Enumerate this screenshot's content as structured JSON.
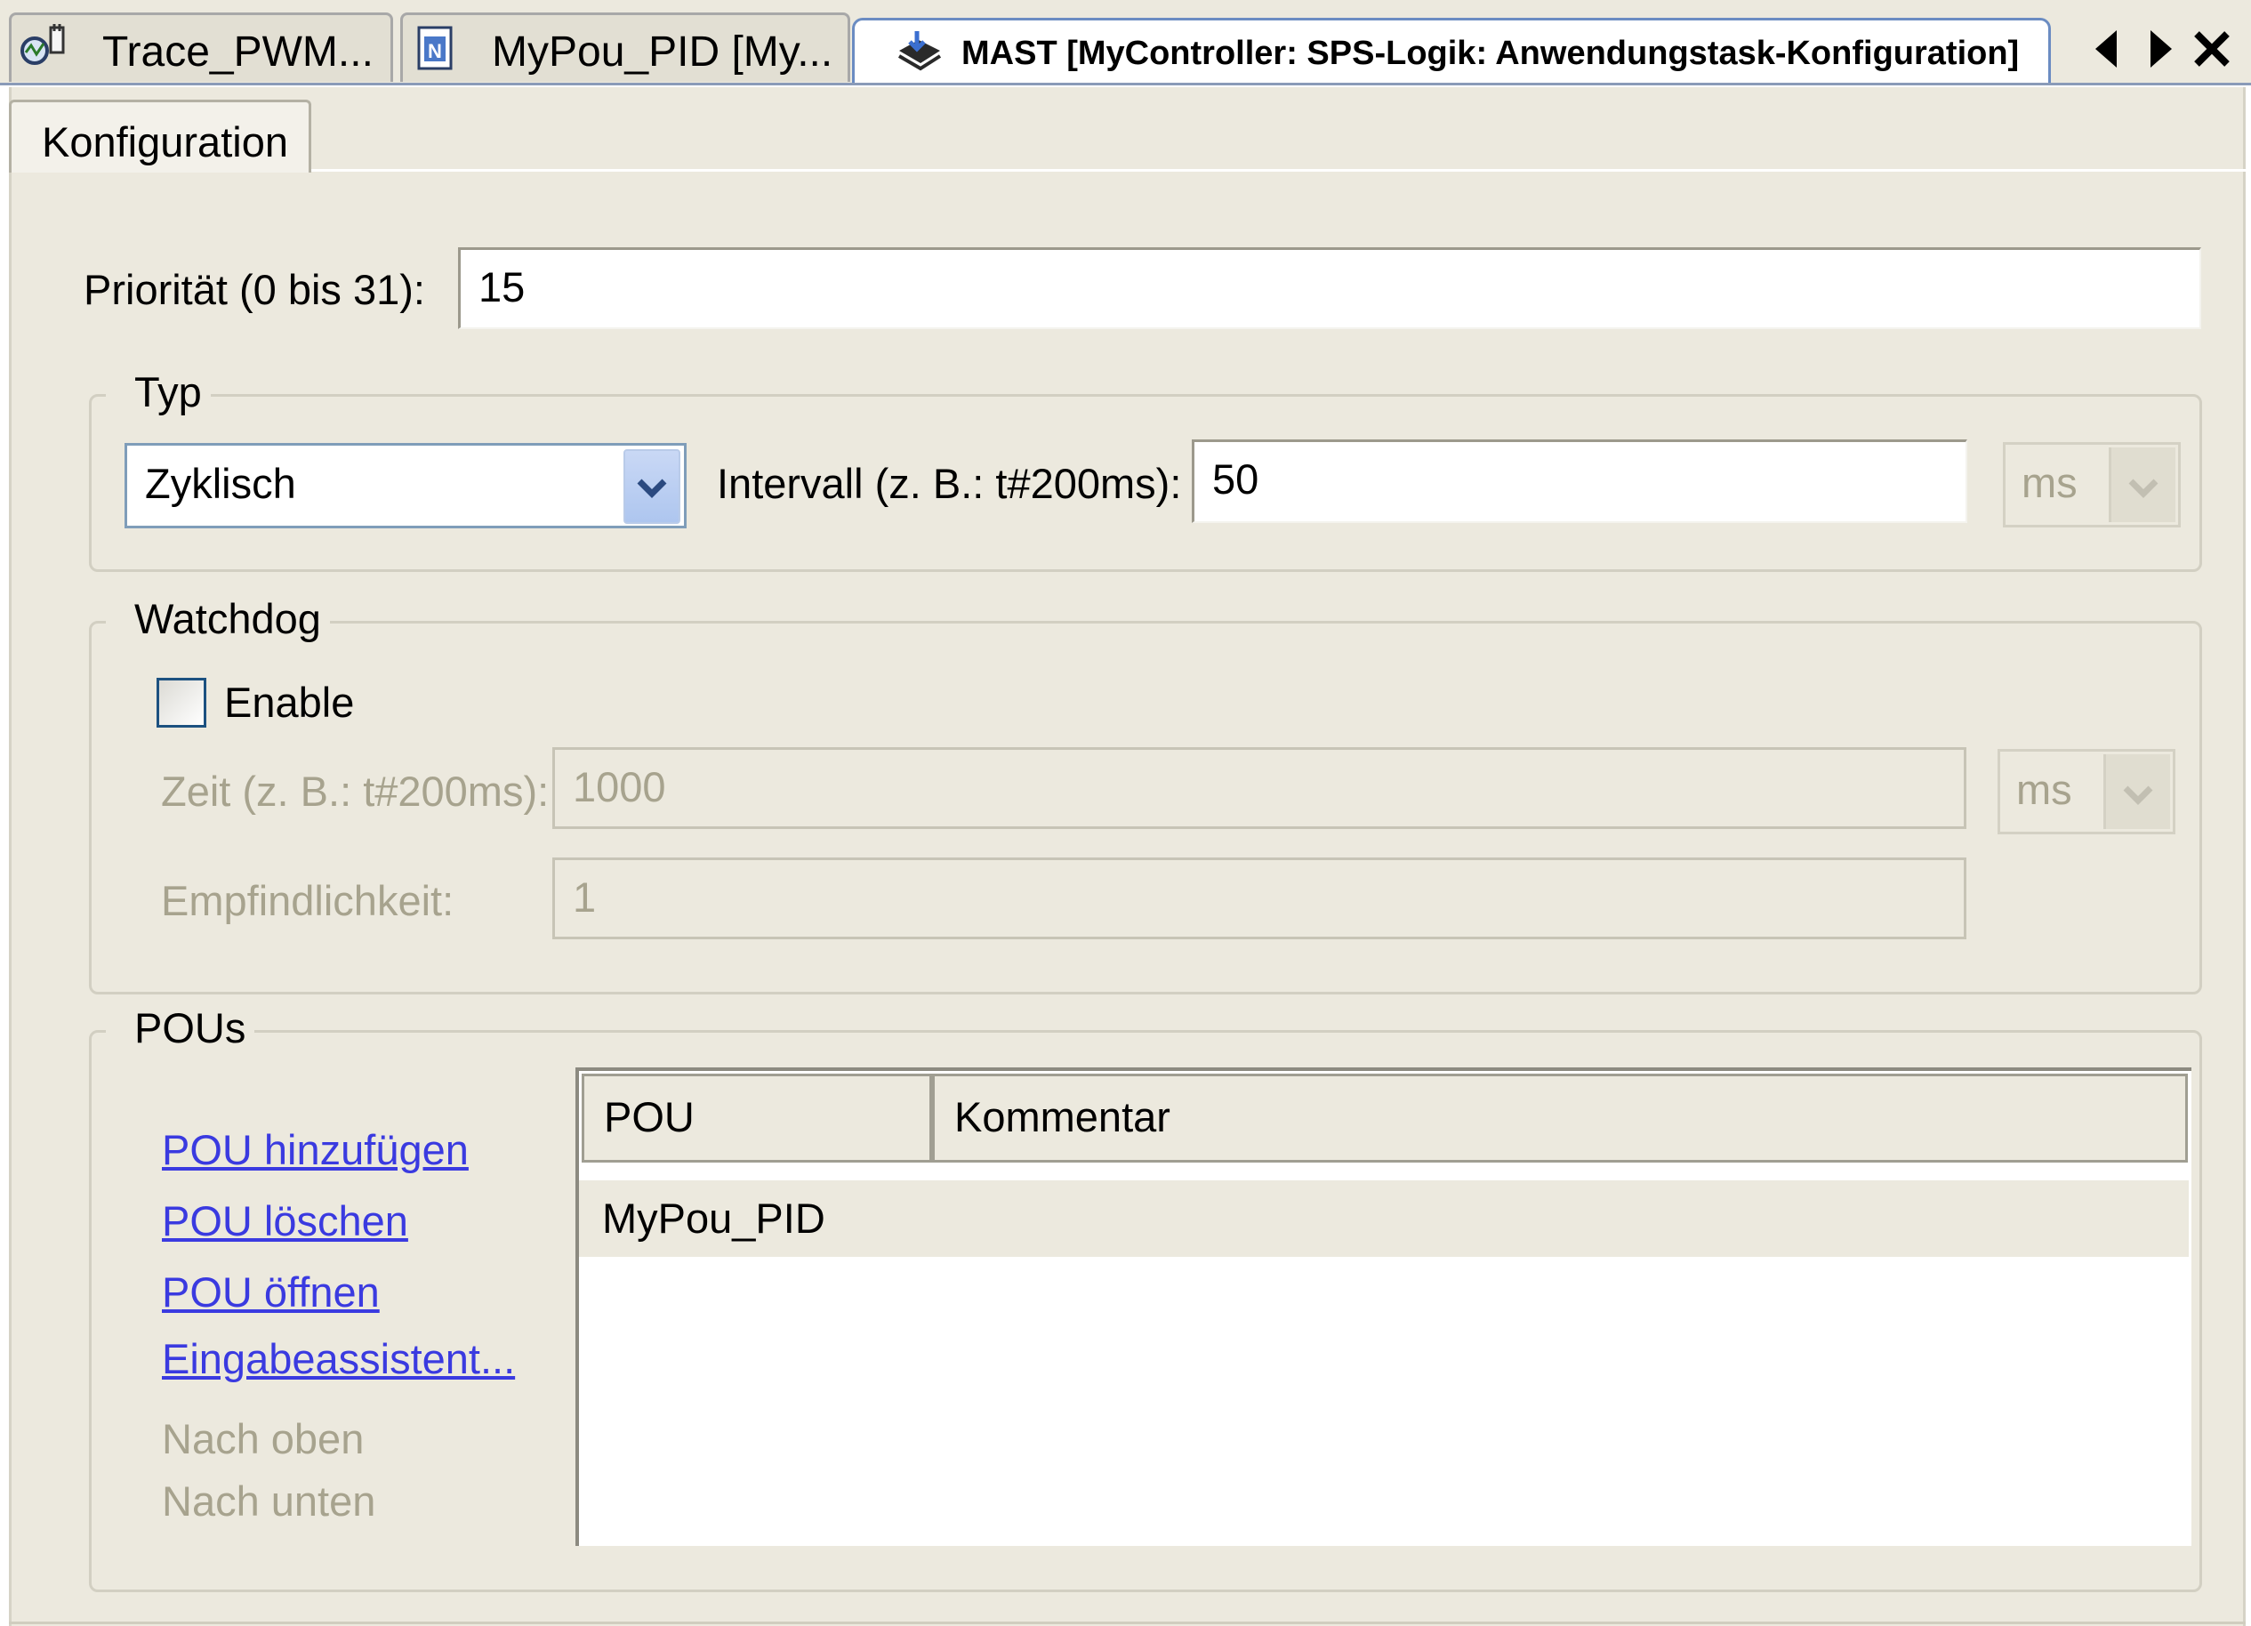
{
  "editor_tabs": [
    {
      "label": "Trace_PWM...",
      "icon": "trace-icon"
    },
    {
      "label": "MyPou_PID [My...",
      "icon": "pou-document-icon"
    },
    {
      "label": "MAST [MyController: SPS-Logik: Anwendungstask-Konfiguration]",
      "icon": "task-icon",
      "active": true
    }
  ],
  "tab_nav": {
    "prev_icon": "triangle-left-icon",
    "next_icon": "triangle-right-icon",
    "close_icon": "close-icon"
  },
  "sub_tab": {
    "label": "Konfiguration"
  },
  "priority": {
    "label": "Priorität (0 bis 31):",
    "value": "15"
  },
  "type_group": {
    "legend": "Typ",
    "type_select": "Zyklisch",
    "interval_label": "Intervall (z. B.: t#200ms):",
    "interval_value": "50",
    "interval_unit": "ms"
  },
  "watchdog_group": {
    "legend": "Watchdog",
    "enable_label": "Enable",
    "enable_checked": false,
    "time_label": "Zeit (z. B.: t#200ms):",
    "time_value": "1000",
    "time_unit": "ms",
    "sensitivity_label": "Empfindlichkeit:",
    "sensitivity_value": "1"
  },
  "pous_group": {
    "legend": "POUs",
    "actions": [
      "POU hinzufügen",
      "POU löschen",
      "POU öffnen",
      "Eingabeassistent..."
    ],
    "disabled_actions": [
      "Nach oben",
      "Nach unten"
    ],
    "table": {
      "columns": [
        "POU",
        "Kommentar"
      ],
      "rows": [
        {
          "pou": "MyPou_PID",
          "comment": ""
        }
      ]
    }
  },
  "colors": {
    "panel_bg": "#ece9de",
    "link": "#3a3ae0",
    "disabled_text": "#a7a38e",
    "active_tab_border": "#6b8cc2"
  }
}
